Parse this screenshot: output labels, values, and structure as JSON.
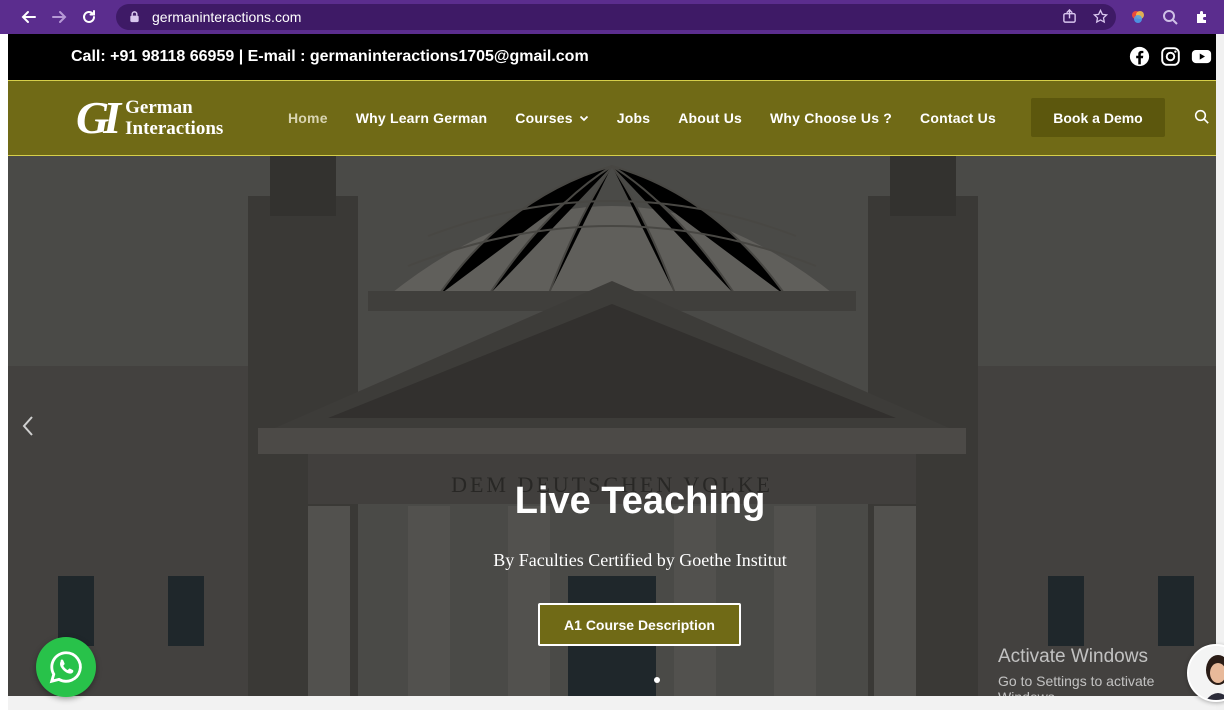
{
  "browser": {
    "url": "germaninteractions.com",
    "colors": {
      "frame": "#5b2d8e",
      "omnibox": "#3e1a66"
    }
  },
  "topbar": {
    "contact_text": "Call: +91 98118 66959 | E-mail : germaninteractions1705@gmail.com",
    "socials": [
      "facebook-icon",
      "instagram-icon",
      "youtube-icon"
    ]
  },
  "nav": {
    "logo_mark": "GI",
    "logo_line1": "German",
    "logo_line2": "Interactions",
    "items": [
      {
        "label": "Home",
        "active": true
      },
      {
        "label": "Why Learn German"
      },
      {
        "label": "Courses",
        "dropdown": true
      },
      {
        "label": "Jobs"
      },
      {
        "label": "About Us"
      },
      {
        "label": "Why Choose Us ?"
      },
      {
        "label": "Contact Us"
      }
    ],
    "demo_button": "Book a Demo",
    "colors": {
      "bar": "#706a16",
      "button": "#5c570d",
      "border": "#d6cf4a"
    }
  },
  "hero": {
    "headline": "Live Teaching",
    "subheadline": "By Faculties Certified by Goethe Institut",
    "cta_label": "A1 Course Description",
    "engraving": "DEM DEUTSCHEN VOLKE",
    "active_slide": 2,
    "slide_count": 3
  },
  "os_watermark": {
    "line1": "Activate Windows",
    "line2": "Go to Settings to activate Windows."
  }
}
